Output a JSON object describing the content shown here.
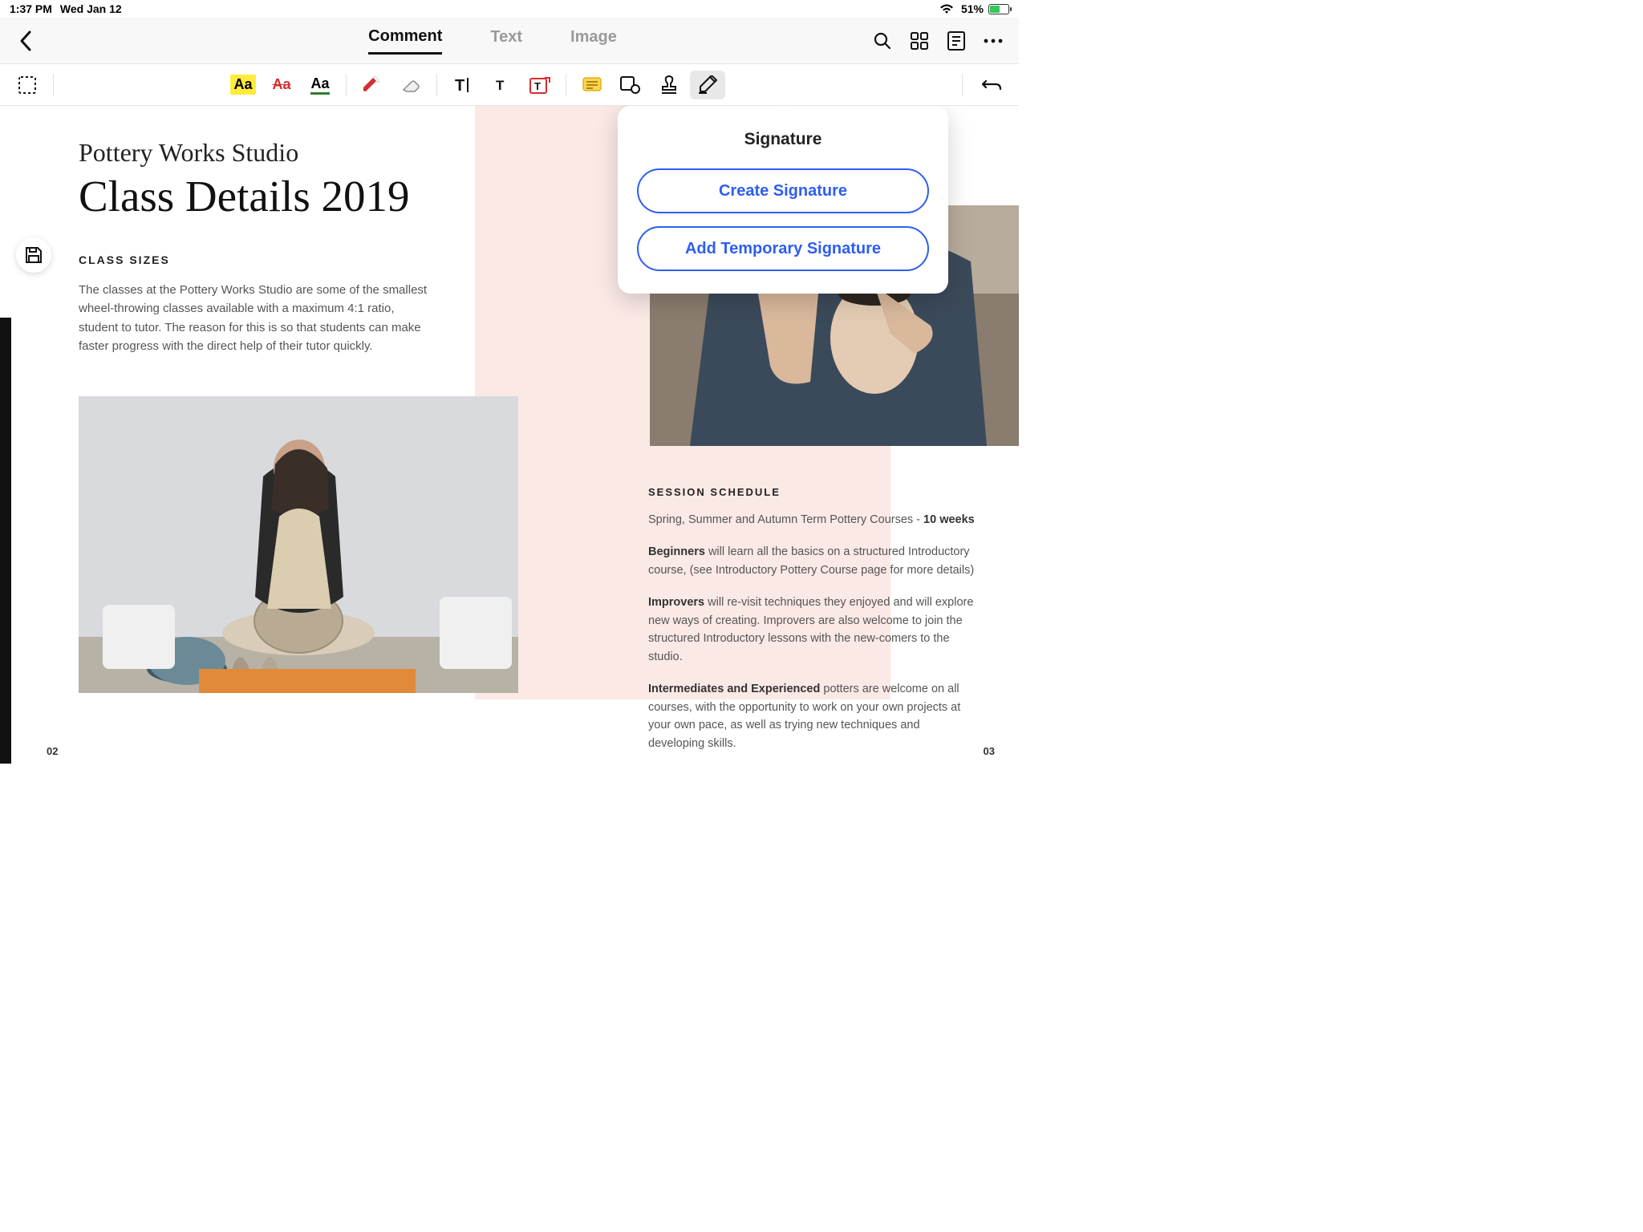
{
  "status": {
    "time": "1:37 PM",
    "date": "Wed Jan 12",
    "battery": "51%"
  },
  "nav": {
    "tabs": {
      "comment": "Comment",
      "text": "Text",
      "image": "Image"
    },
    "active": "comment"
  },
  "popover": {
    "title": "Signature",
    "create": "Create Signature",
    "temp": "Add Temporary Signature"
  },
  "doc": {
    "studio": "Pottery Works Studio",
    "title": "Class Details 2019",
    "classSizesHdr": "CLASS SIZES",
    "classSizesBody": "The classes at the Pottery Works Studio are some of the smallest wheel-throwing classes available with a maximum 4:1 ratio, student to tutor. The reason for this is so that students can make faster progress with the direct help of their tutor quickly.",
    "sessionHdr": "SESSION SCHEDULE",
    "sessionIntroA": "Spring, Summer and Autumn Term Pottery Courses - ",
    "sessionIntroB": "10 weeks",
    "beginnersLabel": "Beginners",
    "beginnersText": " will learn all the basics on a structured Introductory course, (see Introductory Pottery Course page for more details)",
    "improversLabel": "Improvers",
    "improversText": " will re-visit techniques they enjoyed and will explore new ways of creating. Improvers are also welcome to join the structured Introductory lessons with the new-comers to the studio.",
    "intExpLabel": "Intermediates and Experienced",
    "intExpText": " potters are welcome on all courses, with the opportunity to work on your own projects at your own pace, as well as trying new techniques and developing skills.",
    "pageLeft": "02",
    "pageRight": "03"
  }
}
